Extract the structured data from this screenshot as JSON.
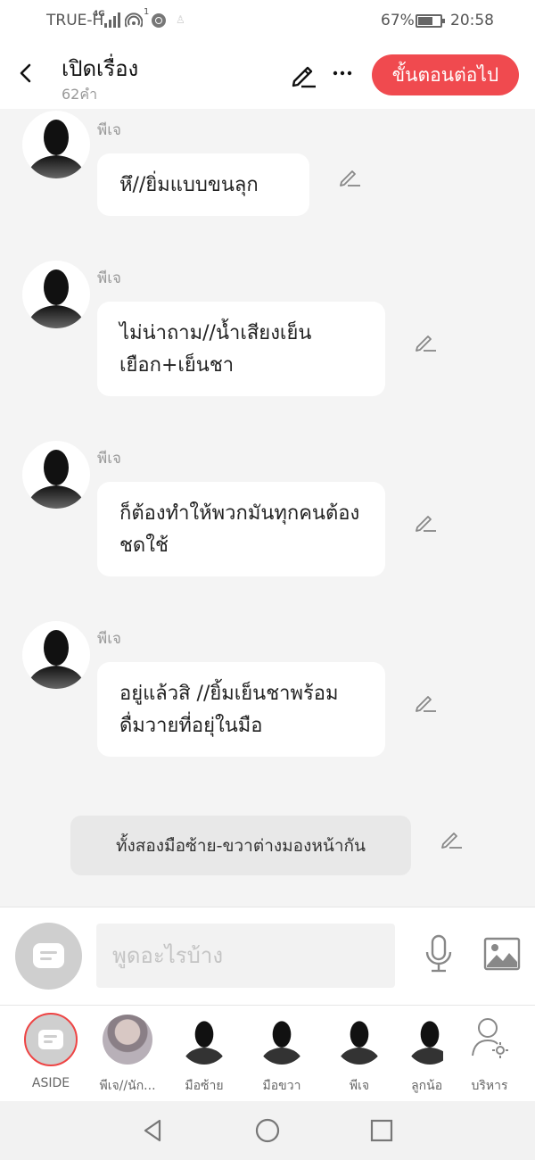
{
  "status_bar": {
    "carrier": "TRUE-H",
    "network": "4G",
    "wifi_badge": "1",
    "battery_percent": "67%",
    "battery_level": 0.67,
    "time": "20:58"
  },
  "header": {
    "title": "เปิดเรื่อง",
    "word_count": "62คำ",
    "next_button": "ขั้นตอนต่อไป",
    "accent_color": "#f04a4f"
  },
  "messages": [
    {
      "speaker": "พีเจ",
      "text": "หึ//ยิ่มแบบขนลุก"
    },
    {
      "speaker": "พีเจ",
      "text": "ไม่น่าถาม//น้ำเสียงเย็นเยือก+เย็นชา"
    },
    {
      "speaker": "พีเจ",
      "text": "ก็ต้องทำให้พวกมันทุกคนต้องชดใช้"
    },
    {
      "speaker": "พีเจ",
      "text": "อยู่แล้วสิ //ยิ้มเย็นชาพร้อมดื่มวายที่อยุ่ในมือ"
    }
  ],
  "aside_text": "ทั้งสองมือซ้าย-ขวาต่างมองหน้ากัน",
  "input": {
    "placeholder": "พูดอะไรบ้าง",
    "value": ""
  },
  "characters": [
    {
      "label": "ASIDE",
      "kind": "aside-icon"
    },
    {
      "label": "พีเจ//นัก...",
      "kind": "photo"
    },
    {
      "label": "มือซ้าย",
      "kind": "silhouette"
    },
    {
      "label": "มือขวา",
      "kind": "silhouette"
    },
    {
      "label": "พีเจ",
      "kind": "silhouette"
    },
    {
      "label": "ลูกน้อง",
      "kind": "silhouette"
    }
  ],
  "manage_label": "บริหาร"
}
